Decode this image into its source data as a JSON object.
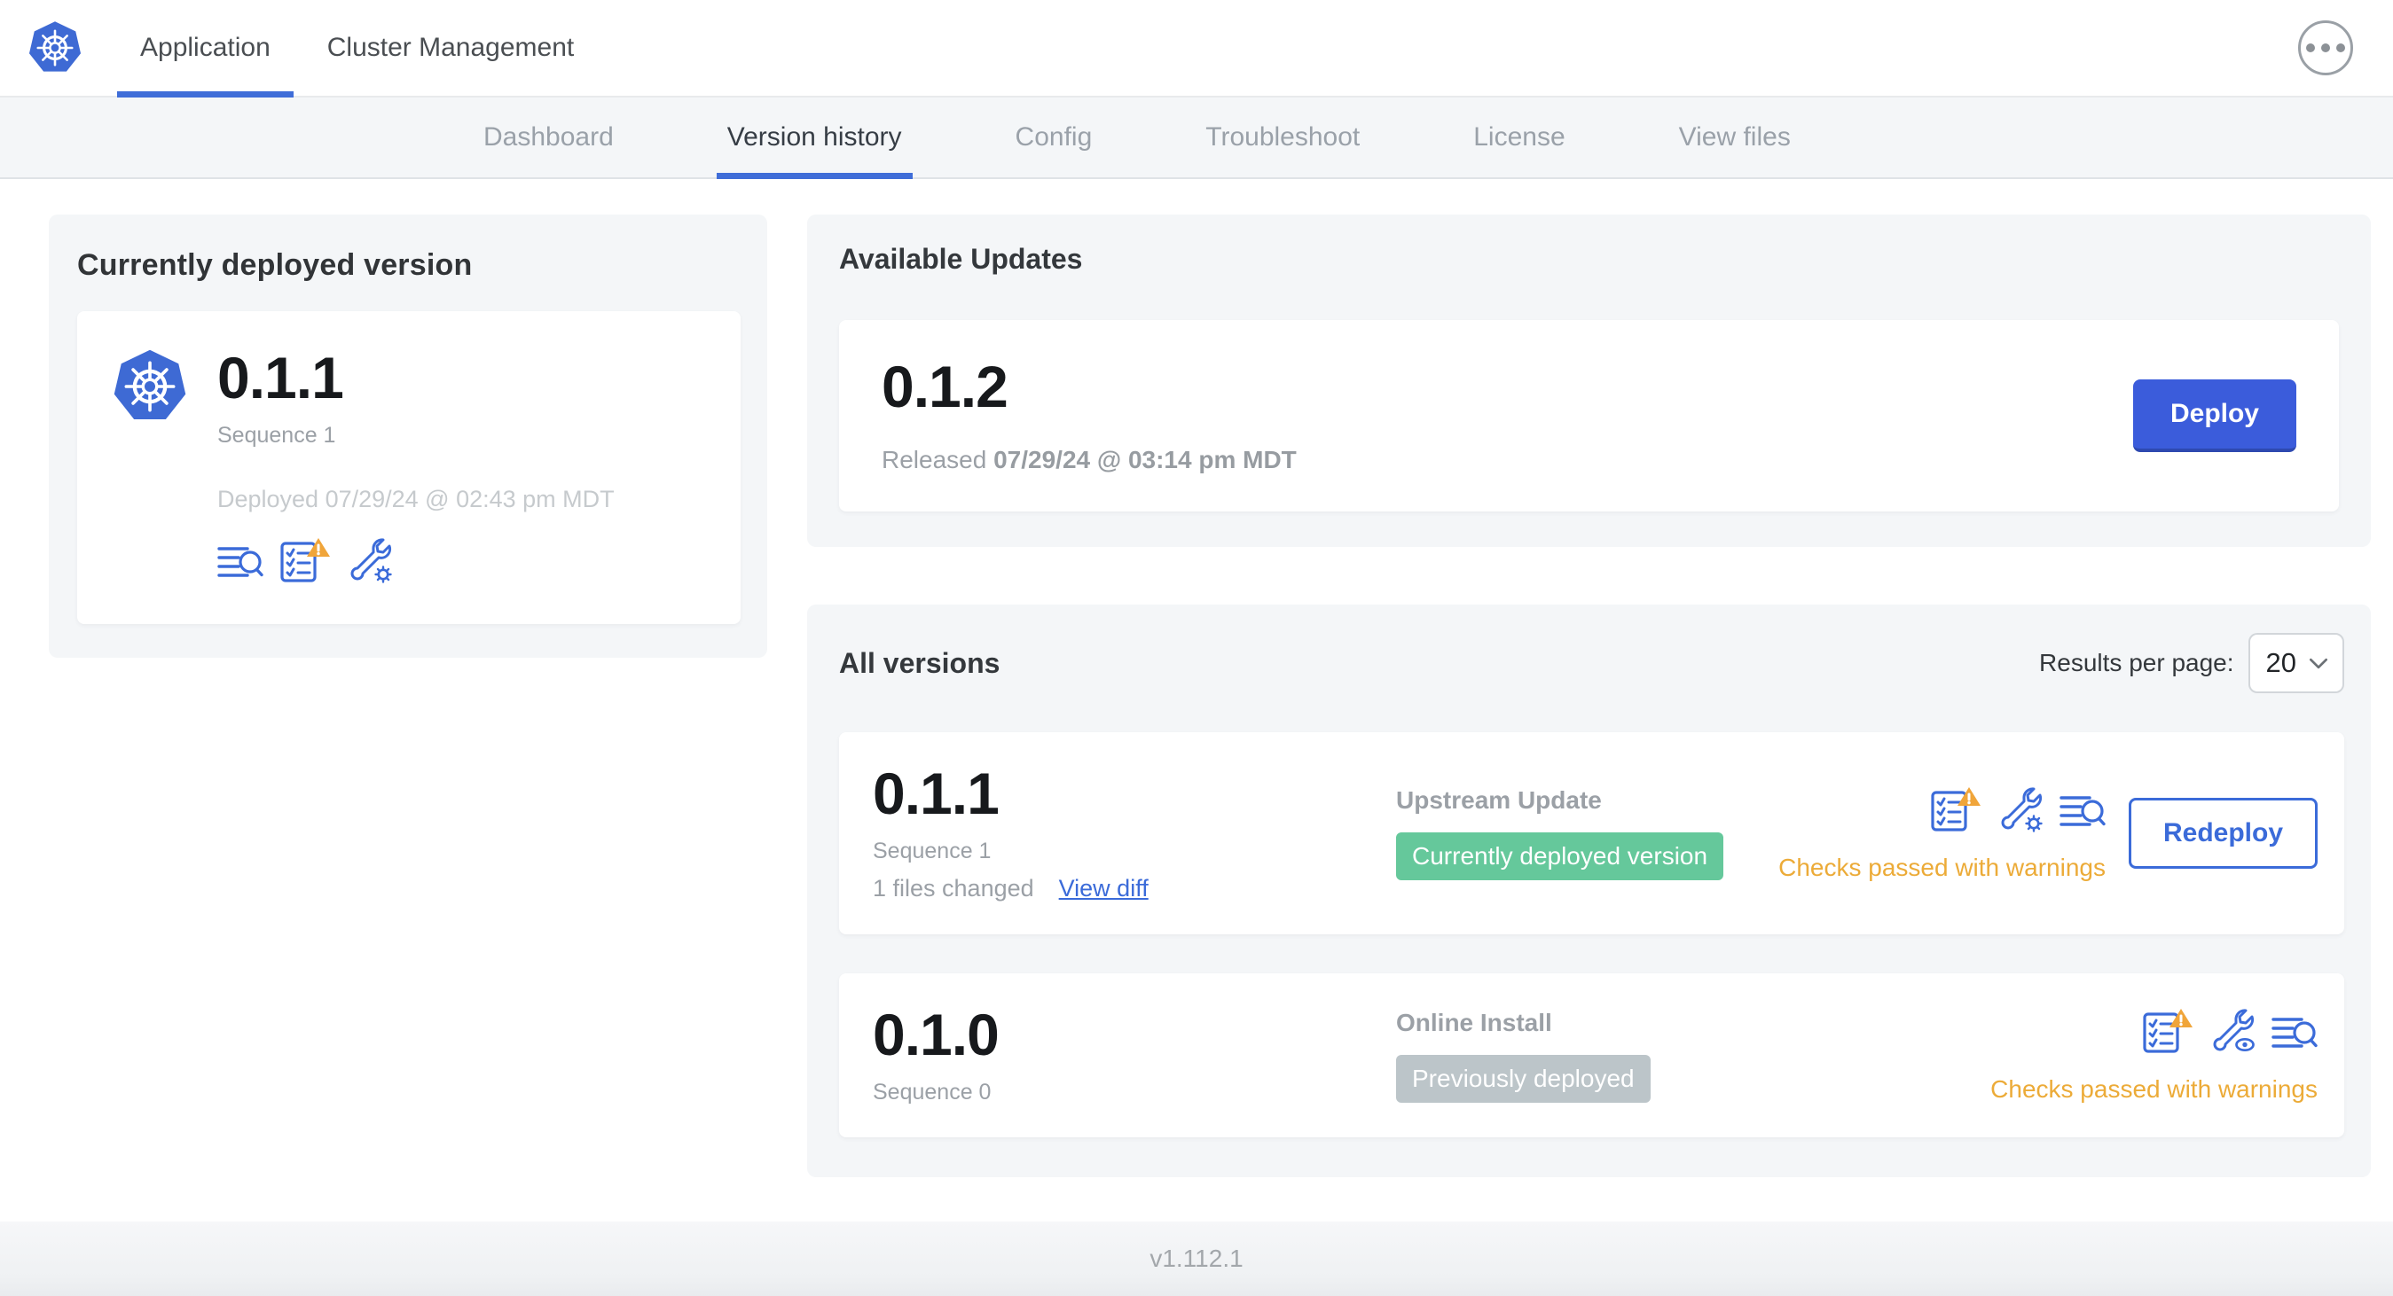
{
  "header": {
    "tabs": [
      {
        "label": "Application"
      },
      {
        "label": "Cluster Management"
      }
    ]
  },
  "subnav": {
    "tabs": [
      "Dashboard",
      "Version history",
      "Config",
      "Troubleshoot",
      "License",
      "View files"
    ],
    "active_tab": "Version history"
  },
  "current_version": {
    "title": "Currently deployed version",
    "version": "0.1.1",
    "sequence": "Sequence 1",
    "deployed": "Deployed 07/29/24 @ 02:43 pm MDT"
  },
  "available_updates": {
    "title": "Available Updates",
    "version": "0.1.2",
    "released_label": "Released",
    "released_date": "07/29/24 @ 03:14 pm MDT",
    "deploy_button": "Deploy"
  },
  "all_versions": {
    "title": "All versions",
    "results_per_page_label": "Results per page:",
    "results_per_page_value": "20",
    "rows": [
      {
        "version": "0.1.1",
        "sequence": "Sequence 1",
        "files_changed": "1 files changed",
        "view_diff_link": "View diff",
        "source": "Upstream Update",
        "badge": "Currently deployed version",
        "status": "Checks passed with warnings",
        "action_button": "Redeploy"
      },
      {
        "version": "0.1.0",
        "sequence": "Sequence 0",
        "source": "Online Install",
        "badge": "Previously deployed",
        "status": "Checks passed with warnings"
      }
    ]
  },
  "footer": {
    "app_version": "v1.112.1"
  },
  "colors": {
    "accent_blue": "#3b6bd9",
    "deploy_button_blue": "#3b5cdb",
    "kubernetes_blue": "#3e6ad4",
    "warning_orange": "#ecab38",
    "badge_green": "#65c89b",
    "badge_gray": "#bcc5c9",
    "panel_gray": "#f4f6f8"
  }
}
